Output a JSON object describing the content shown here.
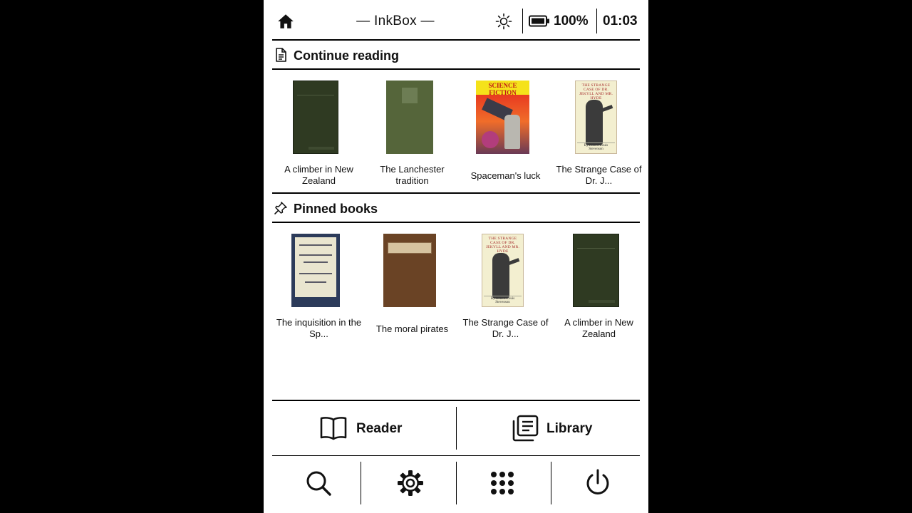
{
  "status_bar": {
    "app_title": "— InkBox —",
    "battery_percent": "100%",
    "time": "01:03",
    "icons": [
      "home-icon",
      "brightness-icon",
      "battery-icon"
    ]
  },
  "continue_reading": {
    "heading": "Continue reading",
    "icon": "document-icon",
    "books": [
      {
        "title": "A climber in New Zealand",
        "lines": [
          "A climber in New",
          "Zealand"
        ]
      },
      {
        "title": "The Lanchester tradition",
        "lines": [
          "The Lanchester",
          "tradition"
        ]
      },
      {
        "title": "Spaceman's luck",
        "lines": [
          "Spaceman's luck"
        ],
        "cover_banner": "SCIENCE FICTION"
      },
      {
        "title": "The Strange Case of Dr. J...",
        "lines": [
          "The Strange Case of",
          "Dr. J..."
        ],
        "cover_text": "THE STRANGE CASE OF DR. JEKYLL AND MR. HYDE",
        "cover_author": "By Robert Louis Stevenson"
      }
    ]
  },
  "pinned_books": {
    "heading": "Pinned books",
    "icon": "pin-icon",
    "books": [
      {
        "title": "The inquisition in the Sp...",
        "lines": [
          "The inquisition in the",
          "Sp..."
        ]
      },
      {
        "title": "The moral pirates",
        "lines": [
          "The moral pirates"
        ]
      },
      {
        "title": "The Strange Case of Dr. J...",
        "lines": [
          "The Strange Case of",
          "Dr. J..."
        ],
        "cover_text": "THE STRANGE CASE OF DR. JEKYLL AND MR. HYDE",
        "cover_author": "By Robert Louis Stevenson"
      },
      {
        "title": "A climber in New Zealand",
        "lines": [
          "A climber in New",
          "Zealand"
        ]
      }
    ]
  },
  "nav": {
    "reader_label": "Reader",
    "library_label": "Library"
  },
  "toolbar": {
    "icons": [
      "search-icon",
      "settings-gear-icon",
      "apps-grid-icon",
      "power-icon"
    ]
  }
}
